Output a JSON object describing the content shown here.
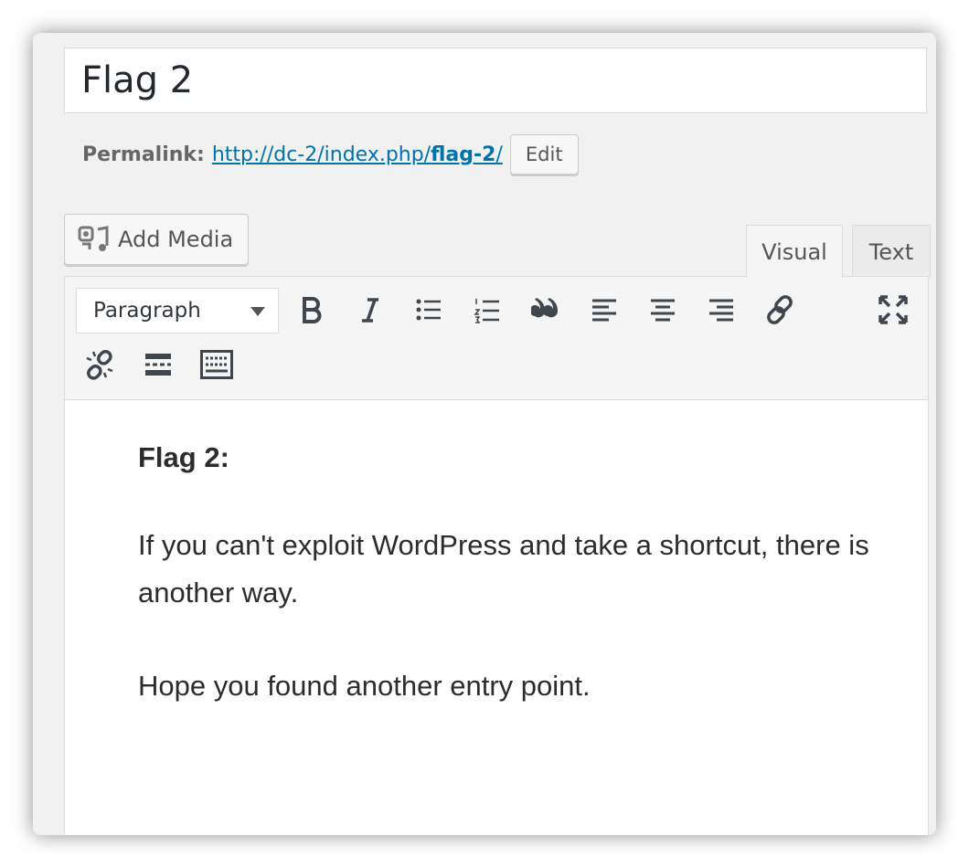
{
  "post": {
    "title": "Flag 2"
  },
  "permalink": {
    "label": "Permalink:",
    "url_base": "http://dc-2/index.php/",
    "url_slug": "flag-2",
    "url_trail": "/",
    "edit_label": "Edit"
  },
  "media": {
    "add_media_label": "Add Media"
  },
  "tabs": {
    "visual": "Visual",
    "text": "Text",
    "active": "Visual"
  },
  "toolbar": {
    "format_value": "Paragraph",
    "buttons": [
      "bold-icon",
      "italic-icon",
      "bullet-list-icon",
      "numbered-list-icon",
      "blockquote-icon",
      "align-left-icon",
      "align-center-icon",
      "align-right-icon",
      "link-icon",
      "fullscreen-icon",
      "unlink-icon",
      "read-more-icon",
      "toolbar-toggle-icon"
    ]
  },
  "content": {
    "heading": "Flag 2:",
    "paragraph1": "If you can't exploit WordPress and take a shortcut, there is another way.",
    "paragraph2": "Hope you found another entry point."
  },
  "colors": {
    "link": "#0073aa",
    "text": "#2c2c2c",
    "background": "#f1f1f1"
  }
}
